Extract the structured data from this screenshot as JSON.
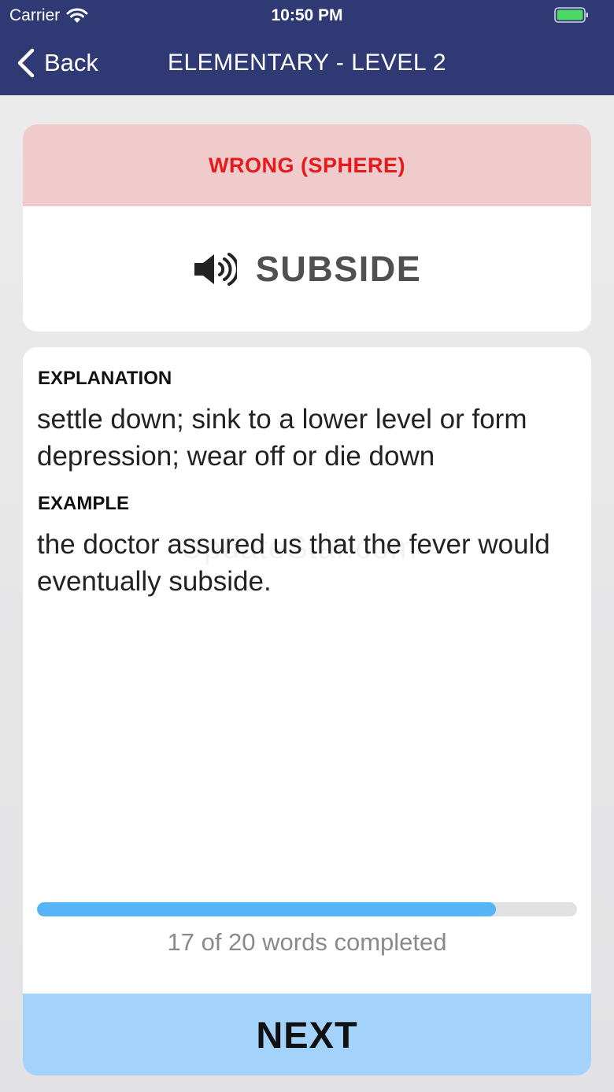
{
  "status_bar": {
    "carrier": "Carrier",
    "time": "10:50 PM",
    "battery_icon": "battery-full-icon",
    "battery_color": "#4cd964"
  },
  "nav": {
    "back_label": "Back",
    "title": "ELEMENTARY - LEVEL 2"
  },
  "result": {
    "text": "WRONG (SPHERE)",
    "color": "#e8191c",
    "banner_color": "#f0cbcb"
  },
  "word": {
    "text": "SUBSIDE",
    "speaker_icon": "speaker-icon"
  },
  "explanation": {
    "label": "EXPLANATION",
    "text": "settle down; sink to a lower level or form depression; wear off or die down"
  },
  "example": {
    "label": "EXAMPLE",
    "text": "the doctor assured us that the fever would eventually subside."
  },
  "watermark": "UpdateStar.com",
  "progress": {
    "completed": 17,
    "total": 20,
    "text": "17 of 20 words completed",
    "fill_color": "#57b4f6"
  },
  "next_button": {
    "label": "NEXT",
    "color": "#a3d2fb"
  },
  "colors": {
    "nav_background": "#2f3a75"
  }
}
